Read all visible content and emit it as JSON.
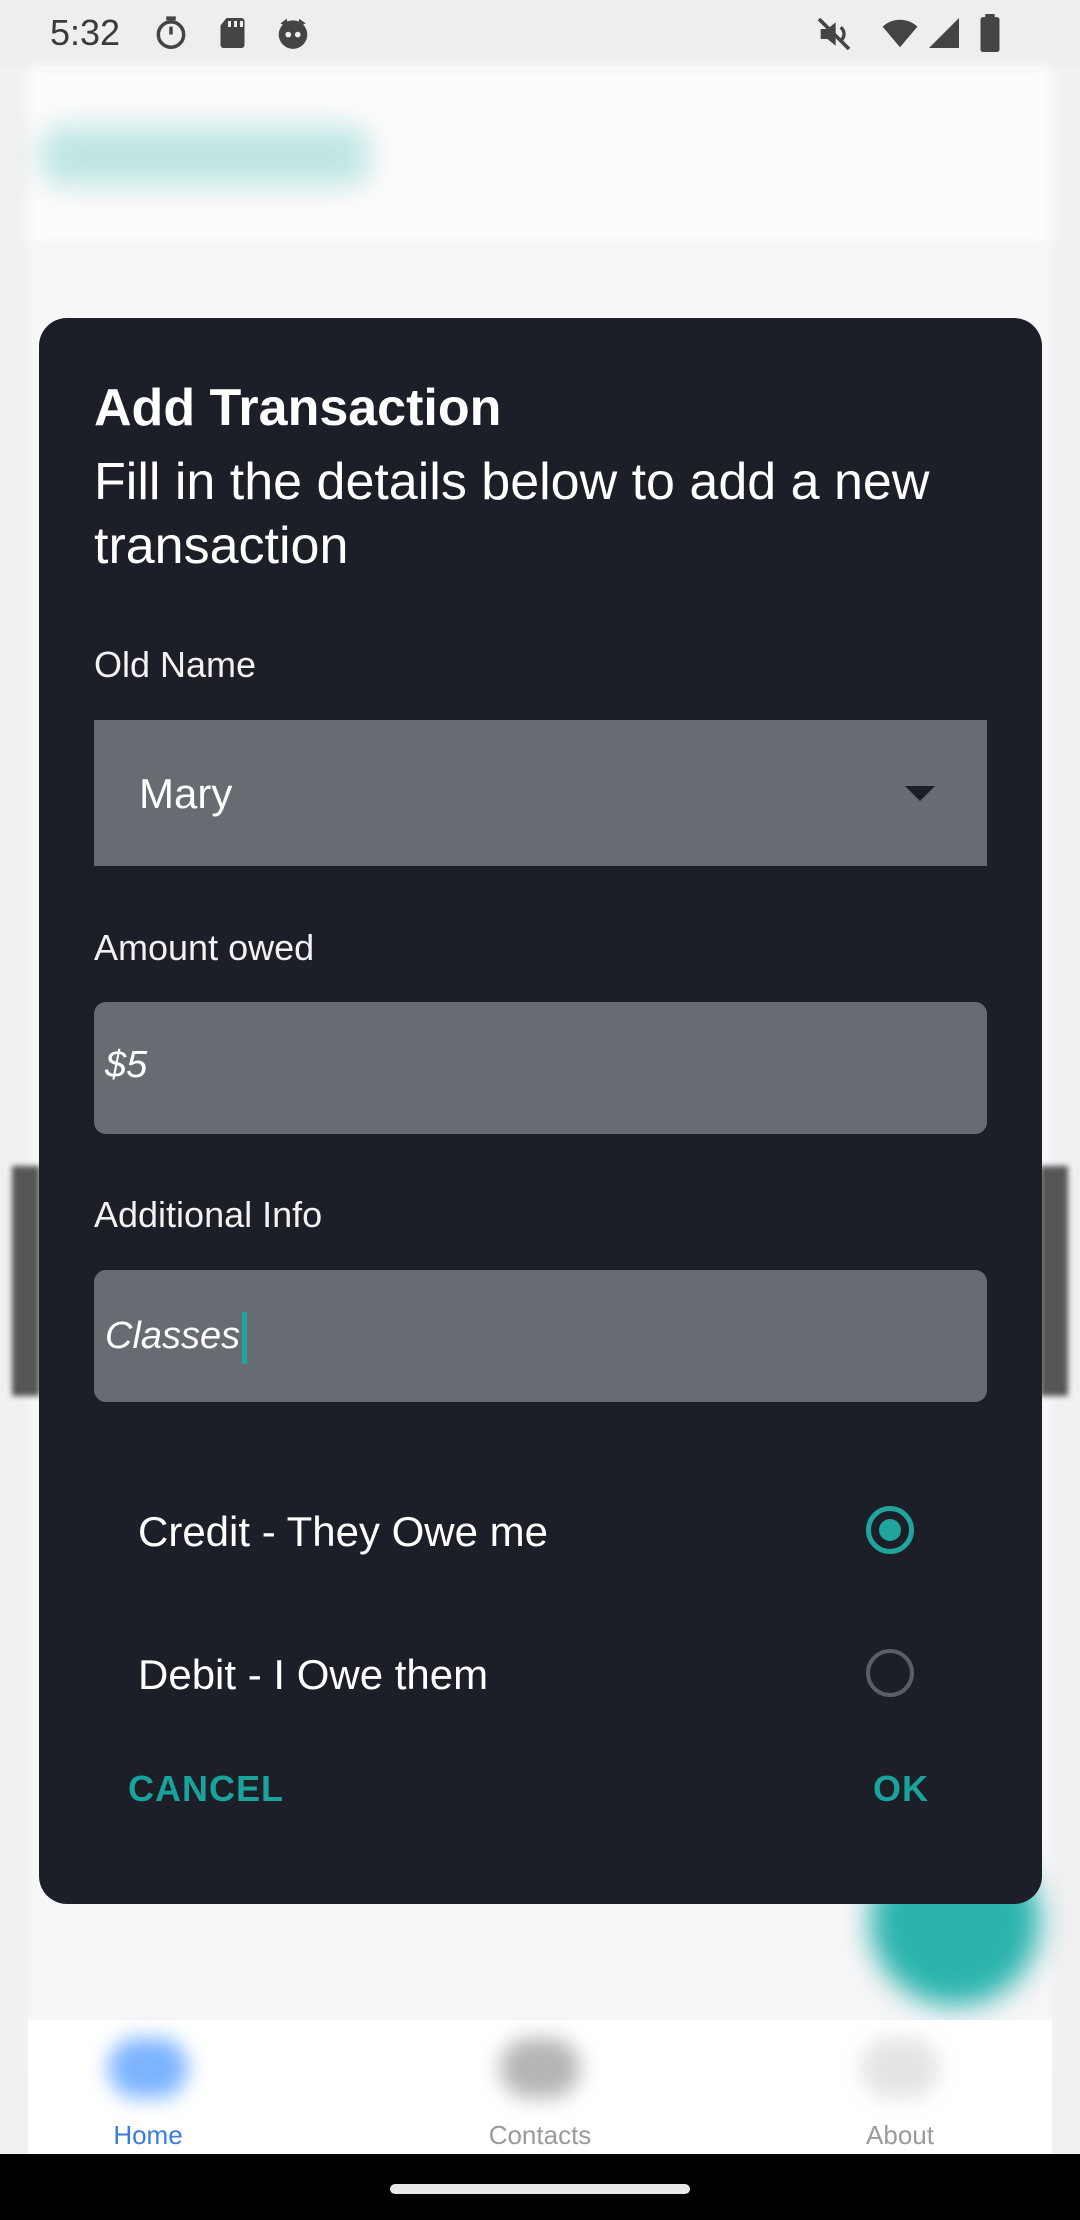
{
  "status_bar": {
    "time": "5:32",
    "left_icons": [
      "timer-icon",
      "sd-card-icon",
      "cat-icon"
    ],
    "right_icons": [
      "mute-icon",
      "wifi-icon",
      "signal-icon",
      "battery-icon"
    ]
  },
  "dialog": {
    "title": "Add Transaction",
    "subtitle": "Fill in the details below to add a new transaction",
    "name_label": "Old Name",
    "name_value": "Mary",
    "amount_label": "Amount owed",
    "amount_value": "$5",
    "info_label": "Additional Info",
    "info_value": "Classes",
    "options": [
      {
        "label": "Credit - They Owe me",
        "selected": true
      },
      {
        "label": "Debit - I Owe them",
        "selected": false
      }
    ],
    "cancel_label": "CANCEL",
    "ok_label": "OK",
    "accent_color": "#1fa59d"
  },
  "bottom_nav": {
    "items": [
      {
        "label": "Home",
        "icon": "home-icon",
        "active": true
      },
      {
        "label": "Contacts",
        "icon": "contacts-icon",
        "active": false
      },
      {
        "label": "About",
        "icon": "about-icon",
        "active": false
      }
    ]
  }
}
